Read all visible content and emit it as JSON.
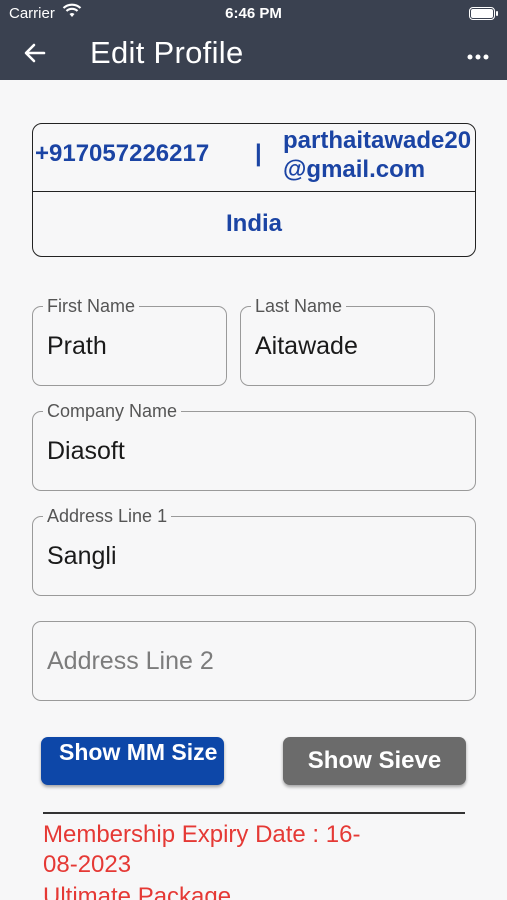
{
  "status_bar": {
    "carrier": "Carrier",
    "time": "6:46 PM"
  },
  "app_bar": {
    "title": "Edit Profile"
  },
  "contact": {
    "phone": "+917057226217",
    "separator": "|",
    "email": "parthaitawade20@gmail.com",
    "country": "India"
  },
  "form": {
    "first_name": {
      "label": "First Name",
      "value": "Prath"
    },
    "last_name": {
      "label": "Last Name",
      "value": "Aitawade"
    },
    "company_name": {
      "label": "Company Name",
      "value": "Diasoft"
    },
    "address_line_1": {
      "label": "Address Line 1",
      "value": "Sangli"
    },
    "address_line_2": {
      "placeholder": "Address Line 2"
    }
  },
  "buttons": {
    "show_mm_size": "Show MM Size",
    "show_sieve": "Show Sieve"
  },
  "membership": {
    "expiry_text": "Membership Expiry Date : 16-08-2023",
    "package": "Ultimate Package"
  },
  "colors": {
    "app_bar": "#3a4150",
    "accent_blue": "#1b44a4",
    "button_blue": "#0d47a8",
    "button_gray": "#6b6b6b",
    "alert_red": "#e53935"
  }
}
